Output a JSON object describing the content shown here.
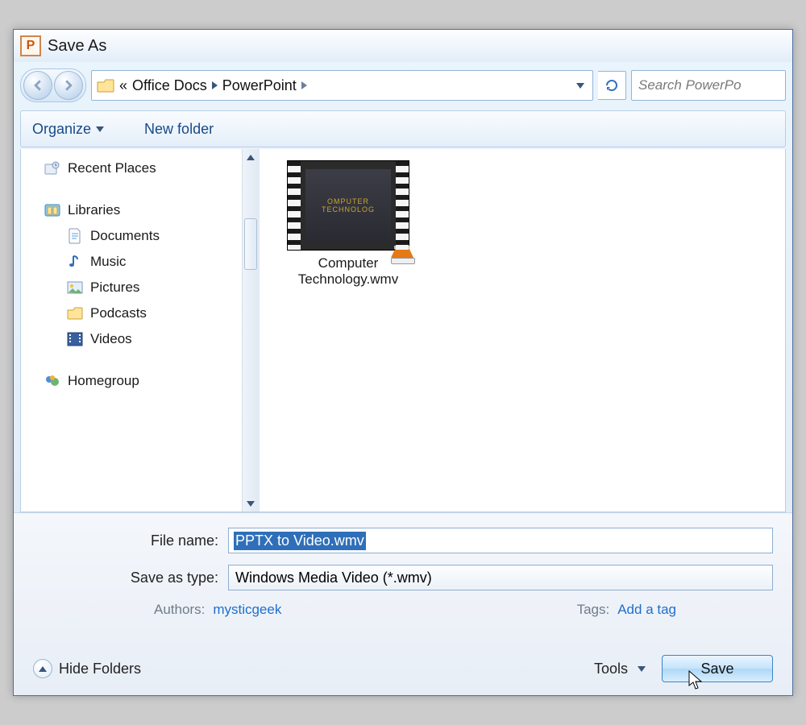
{
  "titlebar": {
    "title": "Save As"
  },
  "nav": {
    "path_prefix": "«",
    "path1": "Office Docs",
    "path2": "PowerPoint",
    "search_placeholder": "Search PowerPo"
  },
  "toolbar": {
    "organize": "Organize",
    "newfolder": "New folder"
  },
  "sidebar": {
    "recent": "Recent Places",
    "libraries": "Libraries",
    "documents": "Documents",
    "music": "Music",
    "pictures": "Pictures",
    "podcasts": "Podcasts",
    "videos": "Videos",
    "homegroup": "Homegroup"
  },
  "content": {
    "thumb_text": "OMPUTER TECHNOLOG",
    "file_line1": "Computer",
    "file_line2": "Technology.wmv"
  },
  "form": {
    "filename_label": "File name:",
    "filename_value": "PPTX to Video.wmv",
    "type_label": "Save as type:",
    "type_value": "Windows Media Video (*.wmv)",
    "authors_label": "Authors:",
    "authors_value": "mysticgeek",
    "tags_label": "Tags:",
    "tags_value": "Add a tag"
  },
  "footer": {
    "hide_folders": "Hide Folders",
    "tools": "Tools",
    "save": "Save"
  }
}
